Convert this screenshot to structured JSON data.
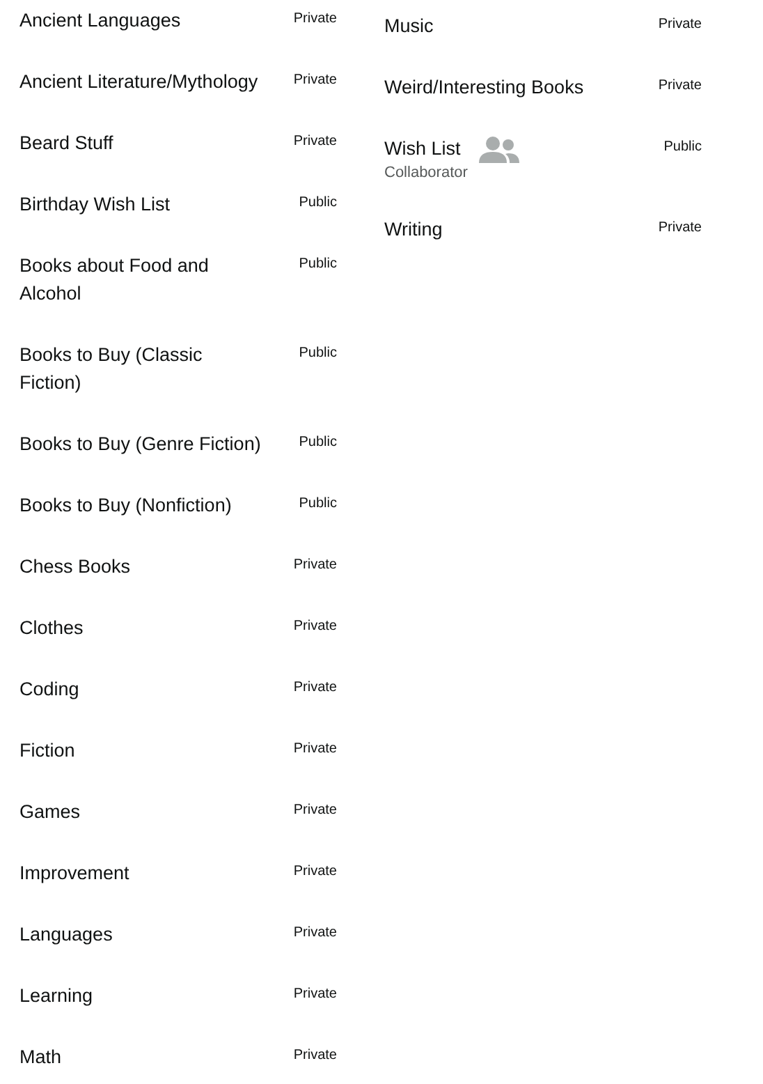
{
  "columns": [
    {
      "lists": [
        {
          "name": "Ancient Languages",
          "visibility": "Private",
          "shared": false
        },
        {
          "name": "Ancient Literature/Mythology",
          "visibility": "Private",
          "shared": false
        },
        {
          "name": "Beard Stuff",
          "visibility": "Private",
          "shared": false
        },
        {
          "name": "Birthday Wish List",
          "visibility": "Public",
          "shared": false
        },
        {
          "name": "Books about Food and Alcohol",
          "visibility": "Public",
          "shared": false
        },
        {
          "name": "Books to Buy (Classic Fiction)",
          "visibility": "Public",
          "shared": false
        },
        {
          "name": "Books to Buy (Genre Fiction)",
          "visibility": "Public",
          "shared": false
        },
        {
          "name": "Books to Buy (Nonfiction)",
          "visibility": "Public",
          "shared": false
        },
        {
          "name": "Chess Books",
          "visibility": "Private",
          "shared": false
        },
        {
          "name": "Clothes",
          "visibility": "Private",
          "shared": false
        },
        {
          "name": "Coding",
          "visibility": "Private",
          "shared": false
        },
        {
          "name": "Fiction",
          "visibility": "Private",
          "shared": false
        },
        {
          "name": "Games",
          "visibility": "Private",
          "shared": false
        },
        {
          "name": "Improvement",
          "visibility": "Private",
          "shared": false
        },
        {
          "name": "Languages",
          "visibility": "Private",
          "shared": false
        },
        {
          "name": "Learning",
          "visibility": "Private",
          "shared": false
        },
        {
          "name": "Math",
          "visibility": "Private",
          "shared": false
        }
      ]
    },
    {
      "lists": [
        {
          "name": "Music",
          "visibility": "Private",
          "shared": false
        },
        {
          "name": "Weird/Interesting Books",
          "visibility": "Private",
          "shared": false
        },
        {
          "name": "Wish List",
          "visibility": "Public",
          "shared": true,
          "role": "Collaborator"
        },
        {
          "name": "Writing",
          "visibility": "Private",
          "shared": false
        }
      ]
    }
  ]
}
